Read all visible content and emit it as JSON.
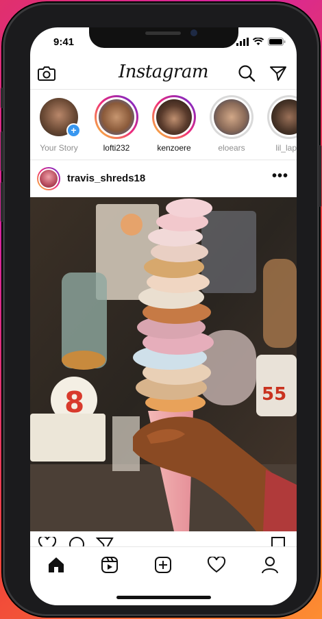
{
  "status": {
    "time": "9:41"
  },
  "header": {
    "logo": "Instagram"
  },
  "icons": {
    "camera": "camera-icon",
    "search": "search-icon",
    "direct": "paper-plane-icon"
  },
  "stories": [
    {
      "name": "Your Story",
      "state": "own",
      "tone": "#6b4a35"
    },
    {
      "name": "lofti232",
      "state": "active",
      "tone": "#8a5a3a"
    },
    {
      "name": "kenzoere",
      "state": "active",
      "tone": "#5a3b2c"
    },
    {
      "name": "eloears",
      "state": "seen",
      "tone": "#8a6a58"
    },
    {
      "name": "lil_lapis",
      "state": "seen",
      "tone": "#4a3528"
    }
  ],
  "post": {
    "username": "travis_shreds18",
    "more_label": "•••"
  },
  "tabs": [
    "home-icon",
    "reels-icon",
    "new-post-icon",
    "activity-heart-icon",
    "profile-icon"
  ],
  "colors": {
    "story_gradient": [
      "#f9ce34",
      "#ee2a7b",
      "#6228d7"
    ],
    "add_story": "#3897f0"
  }
}
